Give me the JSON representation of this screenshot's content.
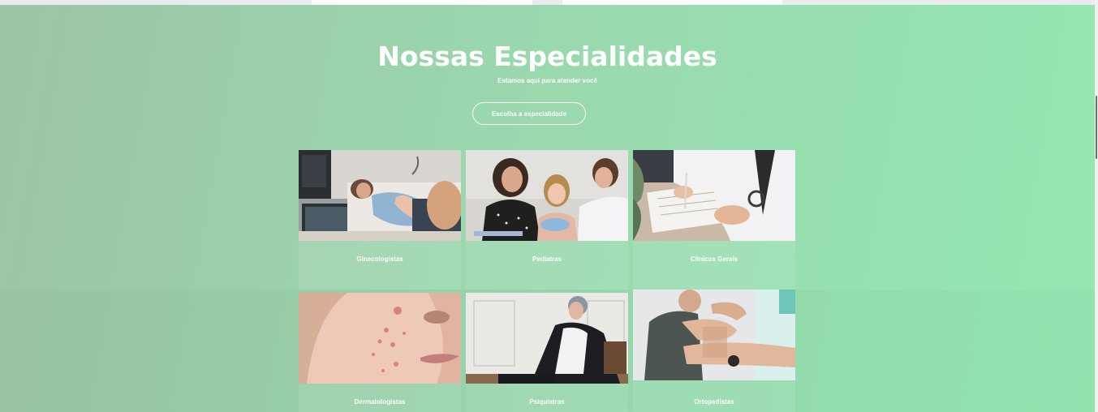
{
  "section": {
    "title": "Nossas Especialidades",
    "subtitle": "Estamos aqui para atender você",
    "cta_label": "Escolha a especialidade"
  },
  "specialties": [
    {
      "label": "Ginecologistas",
      "image": "ultrasound-exam-photo"
    },
    {
      "label": "Pediatras",
      "image": "pediatric-consultation-photo"
    },
    {
      "label": "Clínicos Gerais",
      "image": "doctor-writing-notes-photo"
    },
    {
      "label": "Dermatologistas",
      "image": "skin-acne-closeup-photo"
    },
    {
      "label": "Psiquiatras",
      "image": "psychiatric-session-photo"
    },
    {
      "label": "Ortopedistas",
      "image": "elbow-exam-photo"
    }
  ],
  "colors": {
    "gradient_start": "#9dc5a6",
    "gradient_end": "#95e8b2",
    "text": "#ffffff"
  }
}
